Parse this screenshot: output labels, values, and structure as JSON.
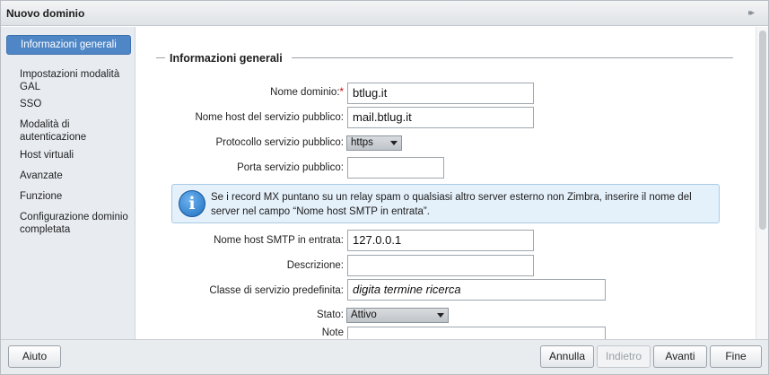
{
  "dialog": {
    "title": "Nuovo dominio",
    "expand_icon": "double-chevron-right-icon"
  },
  "sidebar": {
    "items": [
      {
        "label": "Informazioni generali",
        "active": true
      },
      {
        "label": "Impostazioni modalità GAL"
      },
      {
        "label": "SSO"
      },
      {
        "label": "Modalità di autenticazione"
      },
      {
        "label": "Host virtuali"
      },
      {
        "label": "Avanzate"
      },
      {
        "label": "Funzione"
      },
      {
        "label": "Configurazione dominio completata"
      }
    ]
  },
  "form": {
    "section_title": "Informazioni generali",
    "domain_name": {
      "label": "Nome dominio:",
      "required_mark": "*",
      "value": "btlug.it"
    },
    "public_host": {
      "label": "Nome host del servizio pubblico:",
      "value": "mail.btlug.it"
    },
    "public_protocol": {
      "label": "Protocollo servizio pubblico:",
      "value": "https"
    },
    "public_port": {
      "label": "Porta servizio pubblico:",
      "value": ""
    },
    "info": {
      "icon": "info-icon",
      "text": "Se i record MX puntano su un relay spam o qualsiasi altro server esterno non Zimbra, inserire il nome del server nel campo “Nome host SMTP in entrata”."
    },
    "smtp_host": {
      "label": "Nome host SMTP in entrata:",
      "value": "127.0.0.1"
    },
    "description": {
      "label": "Descrizione:",
      "value": ""
    },
    "default_cos": {
      "label": "Classe di servizio predefinita:",
      "value": "digita termine ricerca"
    },
    "status": {
      "label": "Stato:",
      "value": "Attivo"
    },
    "notes": {
      "label": "Note",
      "value": ""
    }
  },
  "footer": {
    "help": "Aiuto",
    "cancel": "Annulla",
    "back": "Indietro",
    "next": "Avanti",
    "finish": "Fine"
  },
  "colors": {
    "active_nav": "#4f86c6",
    "sidebar_bg": "#e8ecf1",
    "info_bg": "#e4f0fa",
    "required": "#cc0000"
  }
}
